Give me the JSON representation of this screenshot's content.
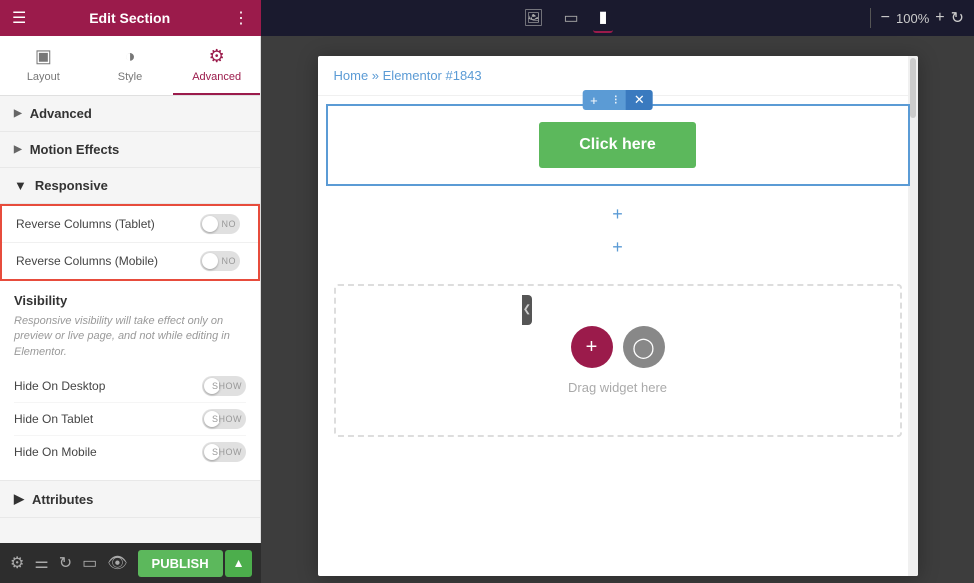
{
  "header": {
    "title": "Edit Section",
    "zoom": "100%"
  },
  "tabs": [
    {
      "id": "layout",
      "label": "Layout",
      "icon": "⊞"
    },
    {
      "id": "style",
      "label": "Style",
      "icon": "◑"
    },
    {
      "id": "advanced",
      "label": "Advanced",
      "icon": "⚙"
    }
  ],
  "sidebar": {
    "sections": [
      {
        "id": "advanced",
        "label": "Advanced",
        "expanded": false
      },
      {
        "id": "motion-effects",
        "label": "Motion Effects",
        "expanded": false
      },
      {
        "id": "responsive",
        "label": "Responsive",
        "expanded": true
      },
      {
        "id": "visibility",
        "label": "Visibility"
      },
      {
        "id": "attributes",
        "label": "Attributes",
        "expanded": false
      }
    ],
    "responsive": {
      "reverse_tablet_label": "Reverse Columns (Tablet)",
      "reverse_mobile_label": "Reverse Columns (Mobile)",
      "toggle_off": "NO"
    },
    "visibility": {
      "title": "Visibility",
      "description": "Responsive visibility will take effect only on preview or live page, and not while editing in Elementor.",
      "hide_desktop_label": "Hide On Desktop",
      "hide_tablet_label": "Hide On Tablet",
      "hide_mobile_label": "Hide On Mobile",
      "show_label": "SHOW"
    }
  },
  "bottom_bar": {
    "publish_label": "PUBLISH"
  },
  "canvas": {
    "breadcrumb": "Home » Elementor #1843",
    "click_here_label": "Click here",
    "drag_widget_text": "Drag widget here"
  }
}
